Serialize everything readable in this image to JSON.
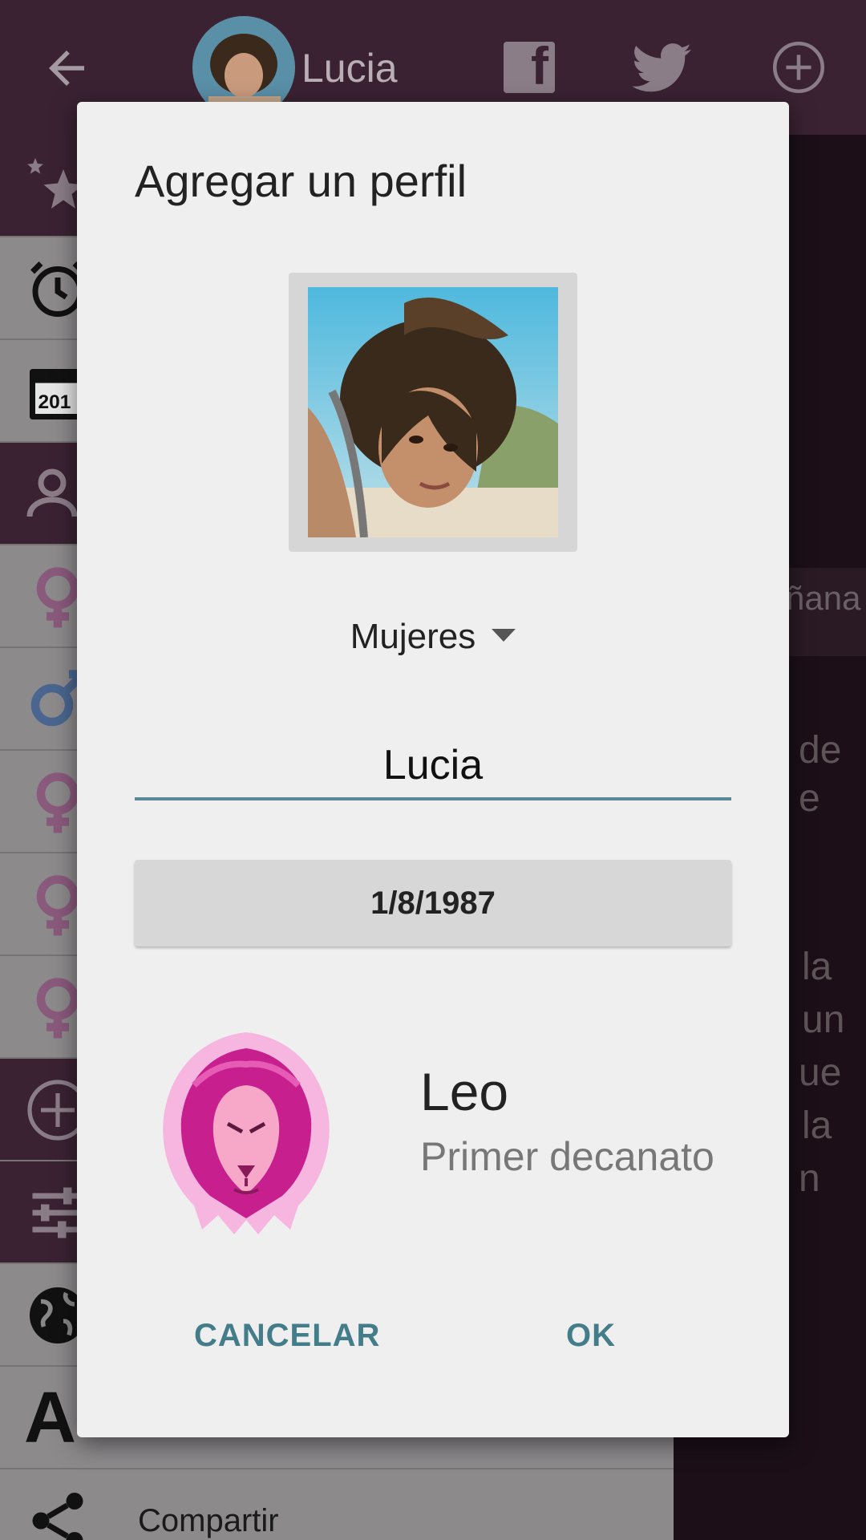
{
  "topbar": {
    "name": "Lucia"
  },
  "drawer": {
    "share_label": "Compartir",
    "font_icon_letter": "A"
  },
  "background_text": {
    "line1": "ñana",
    "line2": "de",
    "line3": "e",
    "line4": "la",
    "line5": "un",
    "line6": "ue",
    "line7": "la",
    "line8": "n"
  },
  "dialog": {
    "title": "Agregar un perfil",
    "group_selected": "Mujeres",
    "name_value": "Lucia",
    "date_value": "1/8/1987",
    "sign_name": "Leo",
    "sign_decanate": "Primer decanato",
    "cancel_label": "CANCELAR",
    "ok_label": "OK"
  },
  "colors": {
    "accent": "#437d8a",
    "topbar": "#3a2232",
    "female_icon": "#8a5a7c",
    "male_icon": "#4a6690"
  }
}
